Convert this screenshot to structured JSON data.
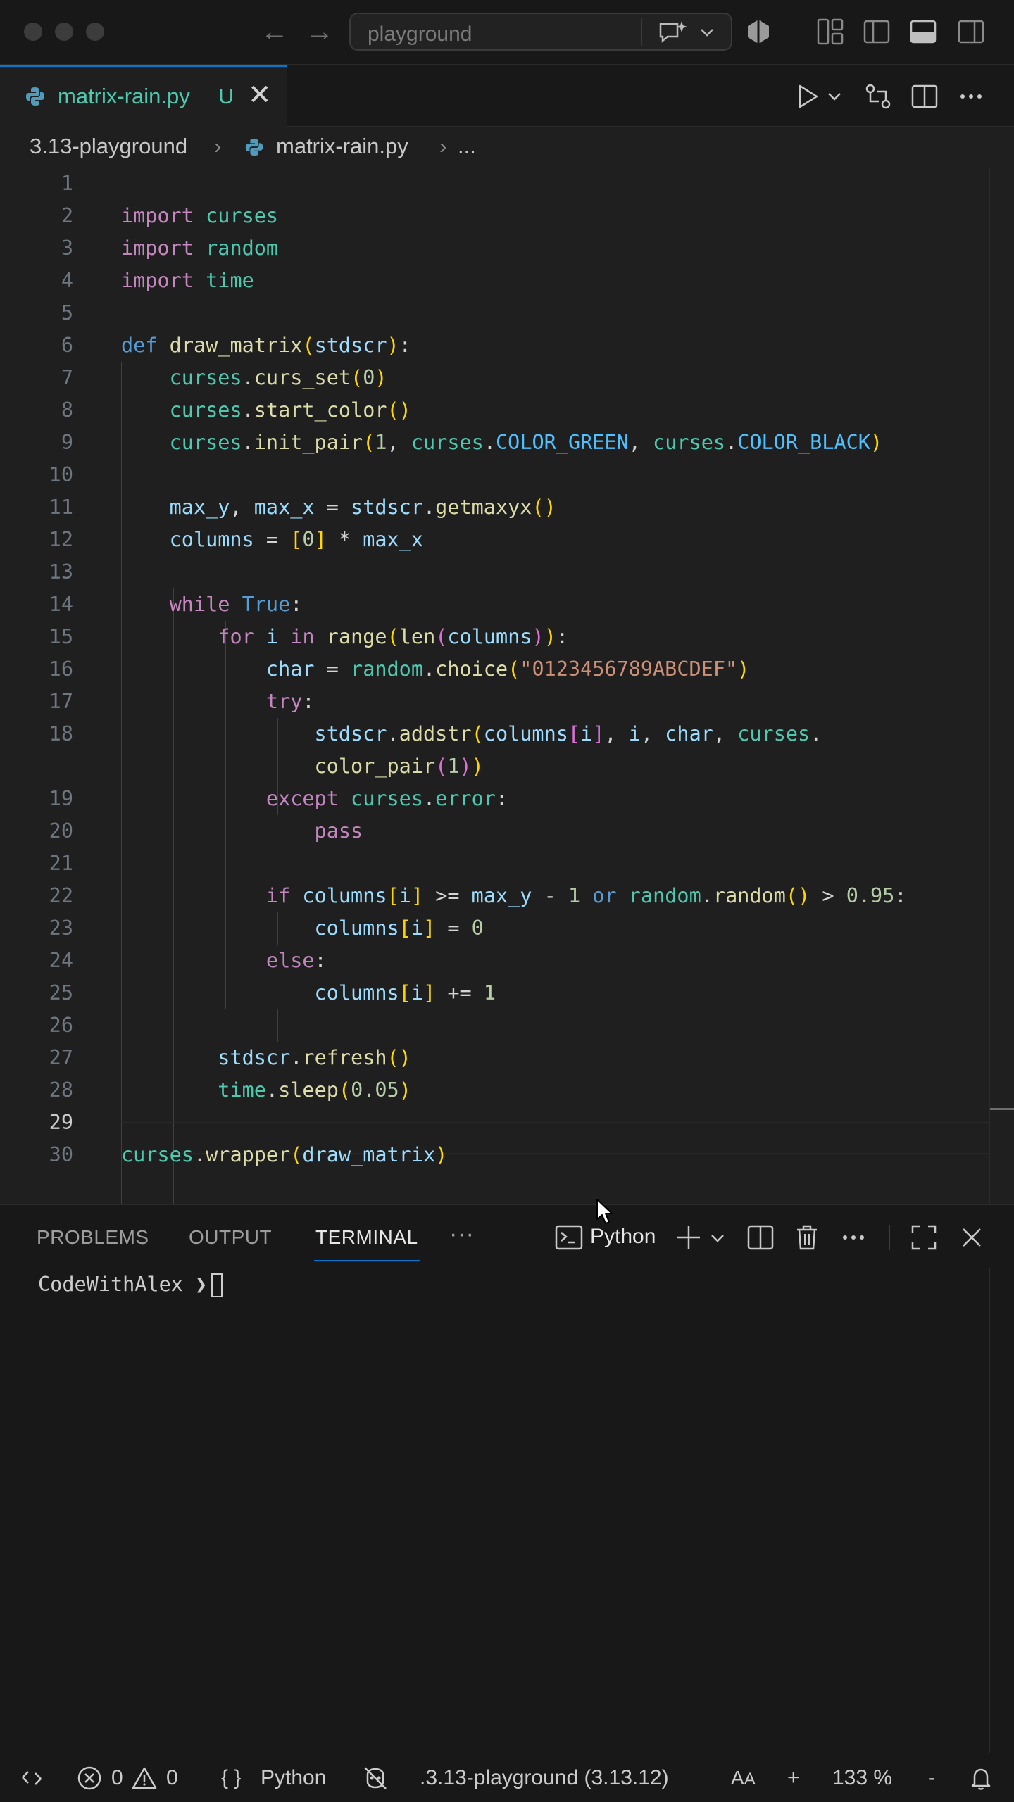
{
  "titlebar": {
    "search_placeholder": "playground"
  },
  "tab": {
    "filename": "matrix-rain.py",
    "status": "U"
  },
  "breadcrumb": {
    "folder": "3.13-playground",
    "file": "matrix-rain.py",
    "more": "..."
  },
  "editor": {
    "line_numbers": [
      "1",
      "2",
      "3",
      "4",
      "5",
      "6",
      "7",
      "8",
      "9",
      "10",
      "11",
      "12",
      "13",
      "14",
      "15",
      "16",
      "17",
      "18",
      "19",
      "20",
      "21",
      "22",
      "23",
      "24",
      "25",
      "26",
      "27",
      "28",
      "29",
      "30"
    ],
    "active_line": "29",
    "code_text": [
      "",
      "import curses",
      "import random",
      "import time",
      "",
      "def draw_matrix(stdscr):",
      "    curses.curs_set(0)",
      "    curses.start_color()",
      "    curses.init_pair(1, curses.COLOR_GREEN, curses.COLOR_BLACK)",
      "",
      "    max_y, max_x = stdscr.getmaxyx()",
      "    columns = [0] * max_x",
      "",
      "    while True:",
      "        for i in range(len(columns)):",
      "            char = random.choice(\"0123456789ABCDEF\")",
      "            try:",
      "                stdscr.addstr(columns[i], i, char, curses.",
      "                color_pair(1))",
      "            except curses.error:",
      "                pass",
      "",
      "            if columns[i] >= max_y - 1 or random.random() > 0.95:",
      "                columns[i] = 0",
      "            else:",
      "                columns[i] += 1",
      "",
      "        stdscr.refresh()",
      "        time.sleep(0.05)",
      "",
      "curses.wrapper(draw_matrix)"
    ]
  },
  "panel": {
    "tabs": [
      "PROBLEMS",
      "OUTPUT",
      "TERMINAL"
    ],
    "active_tab": "TERMINAL",
    "more": "···",
    "terminal_profile": "Python",
    "terminal_prompt": "CodeWithAlex ❯"
  },
  "statusbar": {
    "errors": "0",
    "warnings": "0",
    "language": "Python",
    "interpreter": ".3.13-playground (3.13.12)",
    "zoom_plus": "+",
    "zoom": "133 %",
    "zoom_minus": "-"
  },
  "colors": {
    "accent": "#0078d4",
    "background": "#1f1f1f",
    "chrome": "#181818",
    "keyword": "#c586c0",
    "module": "#4ec9b0",
    "function": "#dcdcaa",
    "string": "#ce9178",
    "number": "#b5cea8"
  }
}
